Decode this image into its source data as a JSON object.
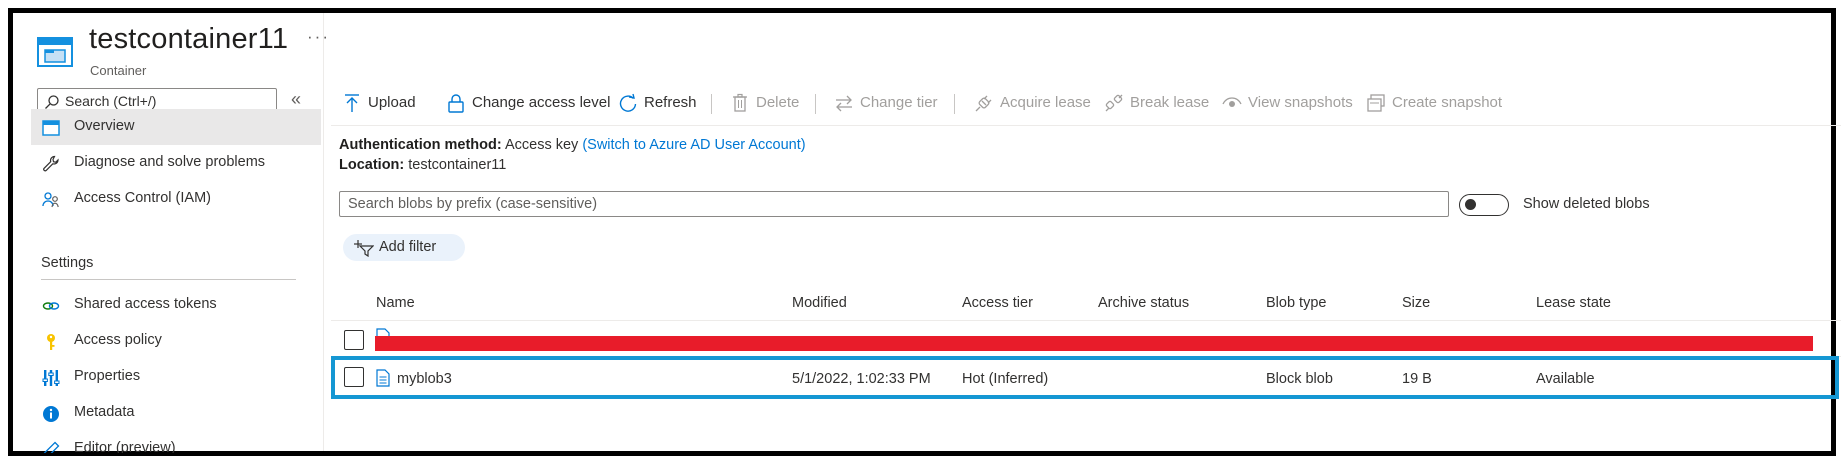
{
  "header": {
    "title": "testcontainer11",
    "subtitle": "Container",
    "more_label": "···"
  },
  "sidebar": {
    "search_placeholder": "Search (Ctrl+/)",
    "collapse_label": "«",
    "items": [
      {
        "label": "Overview",
        "icon": "container-overview-icon"
      },
      {
        "label": "Diagnose and solve problems",
        "icon": "wrench-icon"
      },
      {
        "label": "Access Control (IAM)",
        "icon": "people-icon"
      }
    ],
    "section_title": "Settings",
    "settings_items": [
      {
        "label": "Shared access tokens",
        "icon": "link-icon"
      },
      {
        "label": "Access policy",
        "icon": "key-icon"
      },
      {
        "label": "Properties",
        "icon": "properties-icon"
      },
      {
        "label": "Metadata",
        "icon": "info-icon"
      },
      {
        "label": "Editor (preview)",
        "icon": "pencil-icon"
      }
    ]
  },
  "toolbar": {
    "upload": "Upload",
    "change_access_level": "Change access level",
    "refresh": "Refresh",
    "delete": "Delete",
    "change_tier": "Change tier",
    "acquire_lease": "Acquire lease",
    "break_lease": "Break lease",
    "view_snapshots": "View snapshots",
    "create_snapshot": "Create snapshot"
  },
  "info": {
    "auth_label": "Authentication method:",
    "auth_value": "Access key",
    "auth_link": "(Switch to Azure AD User Account)",
    "location_label": "Location:",
    "location_value": "testcontainer11"
  },
  "filters": {
    "prefix_placeholder": "Search blobs by prefix (case-sensitive)",
    "show_deleted_label": "Show deleted blobs",
    "show_deleted_on": false,
    "add_filter_label": "Add filter"
  },
  "table": {
    "columns": [
      "Name",
      "Modified",
      "Access tier",
      "Archive status",
      "Blob type",
      "Size",
      "Lease state"
    ],
    "rows": [
      {
        "name": "myblob3",
        "modified": "5/1/2022, 1:02:33 PM",
        "access_tier": "Hot (Inferred)",
        "archive_status": "",
        "blob_type": "Block blob",
        "size": "19 B",
        "lease_state": "Available"
      }
    ]
  },
  "colors": {
    "accent": "#0078d4",
    "highlight_border": "#1597d3",
    "redaction": "#e81c2a"
  }
}
